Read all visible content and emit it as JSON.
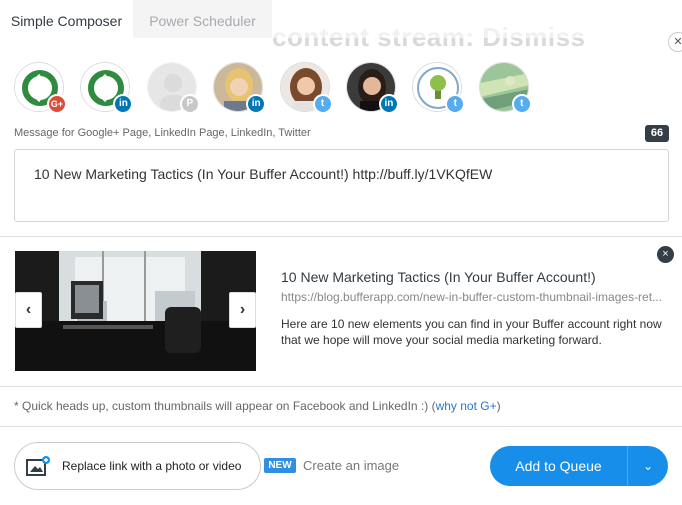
{
  "tabs": [
    {
      "label": "Simple Composer",
      "active": true
    },
    {
      "label": "Power Scheduler",
      "active": false
    }
  ],
  "background_text": "content stream: Dismiss",
  "profiles": [
    {
      "name": "profile-1",
      "network": "gplus",
      "badge": "G+",
      "selected": true
    },
    {
      "name": "profile-2",
      "network": "linkedin",
      "badge": "in",
      "selected": true
    },
    {
      "name": "profile-3",
      "network": "pinterest",
      "badge": "P",
      "selected": false
    },
    {
      "name": "profile-4",
      "network": "linkedin",
      "badge": "in",
      "selected": true
    },
    {
      "name": "profile-5",
      "network": "twitter",
      "badge": "t",
      "selected": true
    },
    {
      "name": "profile-6",
      "network": "linkedin",
      "badge": "in",
      "selected": true
    },
    {
      "name": "profile-7",
      "network": "twitter",
      "badge": "t",
      "selected": true
    },
    {
      "name": "profile-8",
      "network": "twitter",
      "badge": "t",
      "selected": true
    }
  ],
  "composer": {
    "label": "Message for Google+ Page, LinkedIn Page, LinkedIn, Twitter",
    "char_count": "66",
    "text": "10 New Marketing Tactics (In Your Buffer Account!) http://buff.ly/1VKQfEW"
  },
  "link_preview": {
    "title": "10 New Marketing Tactics (In Your Buffer Account!)",
    "url": "https://blog.bufferapp.com/new-in-buffer-custom-thumbnail-images-ret...",
    "description": "Here are 10 new elements you can find in your Buffer account right now that we hope will move your social media marketing forward.",
    "prev_arrow": "‹",
    "next_arrow": "›",
    "close_glyph": "×"
  },
  "hint": {
    "text": "* Quick heads up, custom thumbnails will appear on Facebook and LinkedIn :) (",
    "link": "why not G+",
    "close_paren": ")"
  },
  "footer": {
    "photo_button_label": "Replace link with a photo or video",
    "new_badge": "NEW",
    "create_image": "Create an image",
    "queue_label": "Add to Queue",
    "caret": "⌄"
  },
  "colors": {
    "accent": "#168eea",
    "linkedin": "#0077b5",
    "twitter": "#55acee",
    "gplus": "#dd4b39",
    "dark": "#343e47"
  }
}
